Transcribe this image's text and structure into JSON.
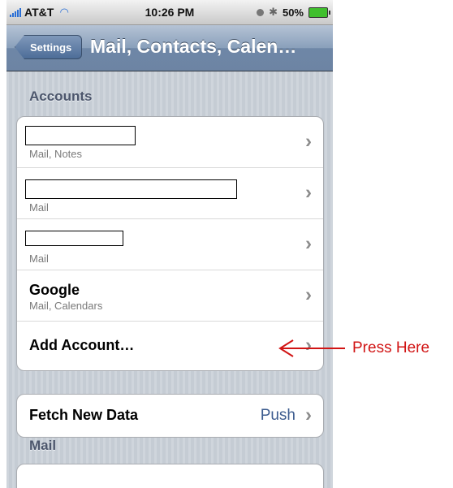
{
  "status_bar": {
    "carrier": "AT&T",
    "time": "10:26 PM",
    "battery_percent": "50%",
    "icons": [
      "signal-bars-icon",
      "wifi-icon",
      "lock-rotation-icon",
      "bluetooth-icon",
      "battery-icon"
    ]
  },
  "nav": {
    "back_label": "Settings",
    "title": "Mail, Contacts, Calen…"
  },
  "sections": {
    "accounts_header": "Accounts",
    "mail_header": "Mail"
  },
  "accounts": [
    {
      "name": "",
      "detail": "Mail, Notes",
      "name_redacted": true
    },
    {
      "name": "",
      "detail": "Mail",
      "name_redacted": true
    },
    {
      "name": "",
      "detail": "Mail",
      "name_redacted": true
    },
    {
      "name": "Google",
      "detail": "Mail, Calendars",
      "name_redacted": false
    }
  ],
  "add_account": {
    "label": "Add Account…"
  },
  "fetch": {
    "label": "Fetch New Data",
    "value": "Push"
  },
  "annotation": {
    "text": "Press Here",
    "color": "#d11414"
  },
  "colors": {
    "nav_bar": "#6d84a3",
    "background": "#c5ccd4",
    "value_text": "#3d5c8f"
  }
}
